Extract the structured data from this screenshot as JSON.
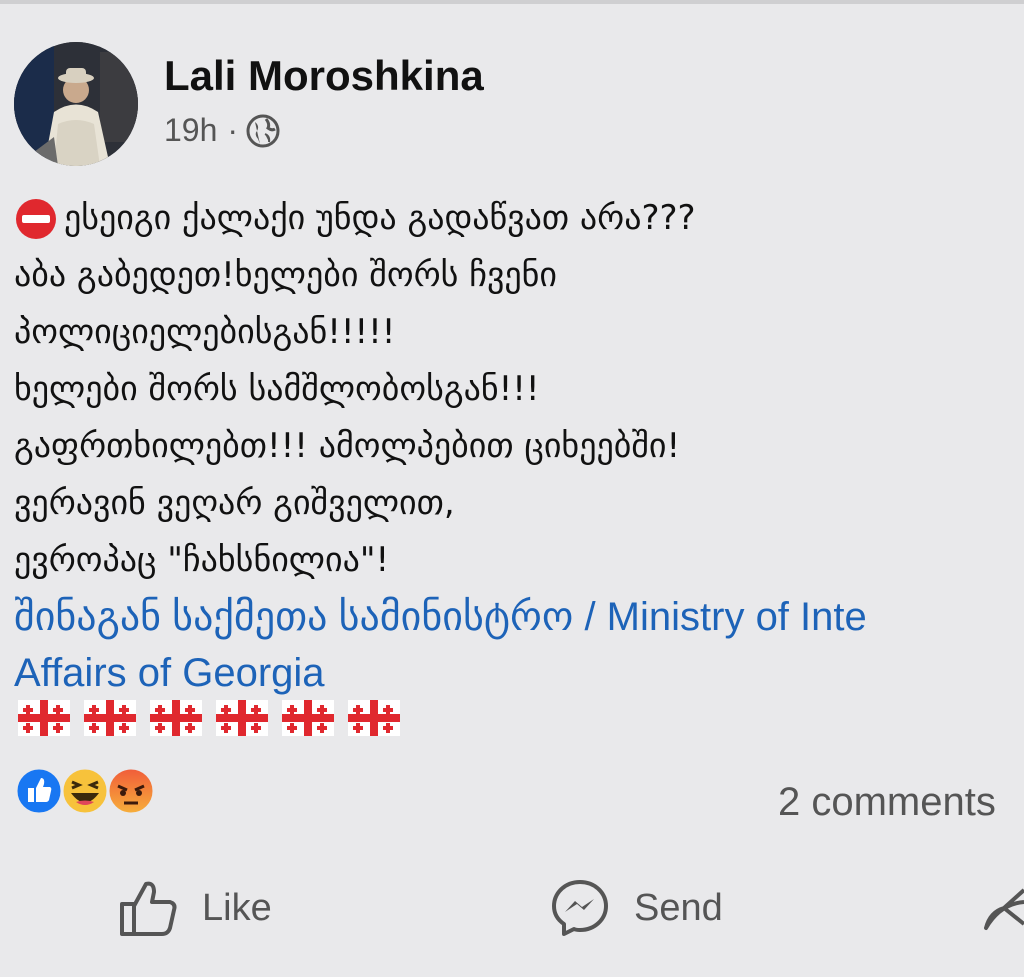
{
  "post": {
    "author": "Lali Moroshkina",
    "time": "19h",
    "separator": "·",
    "privacy_icon": "globe-icon",
    "text_lines": [
      "ესეიგი ქალაქი უნდა გადაწვათ არა???",
      "აბა გაბედეთ!ხელები შორს ჩვენი",
      "პოლიციელებისგან!!!!!",
      "ხელები შორს სამშლობოსგან!!!",
      "გაფრთხილებთ!!! ამოლპებით ციხეებში!",
      "ვერავინ ვეღარ გიშველით,",
      "ევროპაც \"ჩახსნილია\"!"
    ],
    "leading_icon": "no-entry-icon",
    "mention_line1": "შინაგან საქმეთა სამინისტრო / Ministry of Inte",
    "mention_line2": "Affairs of Georgia",
    "flag_icons": [
      "georgia-flag-icon",
      "georgia-flag-icon",
      "georgia-flag-icon",
      "georgia-flag-icon",
      "georgia-flag-icon",
      "georgia-flag-icon"
    ]
  },
  "reactions": {
    "icons": [
      "like-reaction-icon",
      "haha-reaction-icon",
      "angry-reaction-icon"
    ],
    "comments_label": "2 comments"
  },
  "actions": {
    "like_label": "Like",
    "send_label": "Send"
  },
  "colors": {
    "link": "#1d63b8",
    "background": "#e9e9eb",
    "like_blue": "#1877f2"
  }
}
